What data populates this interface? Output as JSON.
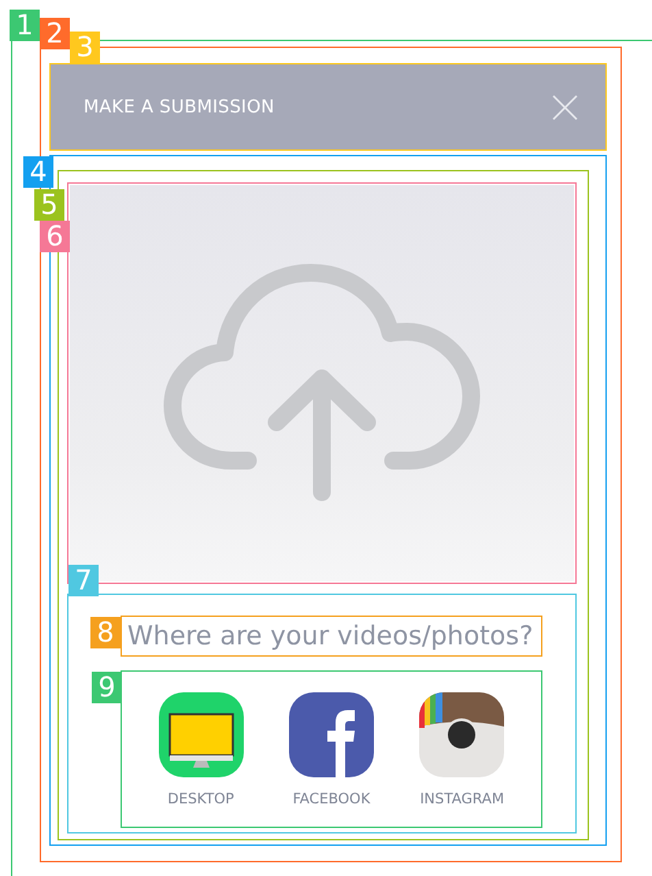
{
  "annotations": [
    {
      "label": "1",
      "color": "#3cc872"
    },
    {
      "label": "2",
      "color": "#ff6b2b"
    },
    {
      "label": "3",
      "color": "#ffc81e"
    },
    {
      "label": "4",
      "color": "#14a0f0"
    },
    {
      "label": "5",
      "color": "#9bc31e"
    },
    {
      "label": "6",
      "color": "#f57896"
    },
    {
      "label": "7",
      "color": "#50c8e1"
    },
    {
      "label": "8",
      "color": "#f5a01e"
    },
    {
      "label": "9",
      "color": "#3cc872"
    }
  ],
  "modal": {
    "title": "MAKE A SUBMISSION"
  },
  "source_prompt": {
    "placeholder": "Where are your videos/photos?"
  },
  "sources": [
    {
      "kind": "desktop",
      "label": "DESKTOP"
    },
    {
      "kind": "facebook",
      "label": "FACEBOOK"
    },
    {
      "kind": "instagram",
      "label": "INSTAGRAM"
    }
  ]
}
